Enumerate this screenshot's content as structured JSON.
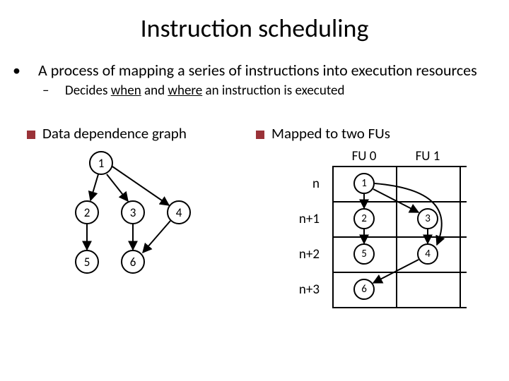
{
  "title": "Instruction scheduling",
  "bullets": {
    "b1": "A process of mapping a series of instructions into execution resources",
    "b2_pre": "Decides ",
    "b2_when": "when",
    "b2_mid": " and ",
    "b2_where": "where",
    "b2_post": " an instruction is executed"
  },
  "left_heading": "Data dependence graph",
  "right_heading": "Mapped to two FUs",
  "graph_nodes": {
    "n1": "1",
    "n2": "2",
    "n3": "3",
    "n4": "4",
    "n5": "5",
    "n6": "6"
  },
  "table": {
    "col0": "FU 0",
    "col1": "FU 1",
    "row0": "n",
    "row1": "n+1",
    "row2": "n+2",
    "row3": "n+3",
    "c_r0c0": "1",
    "c_r1c0": "2",
    "c_r1c1": "3",
    "c_r2c0": "5",
    "c_r2c1": "4",
    "c_r3c0": "6"
  }
}
